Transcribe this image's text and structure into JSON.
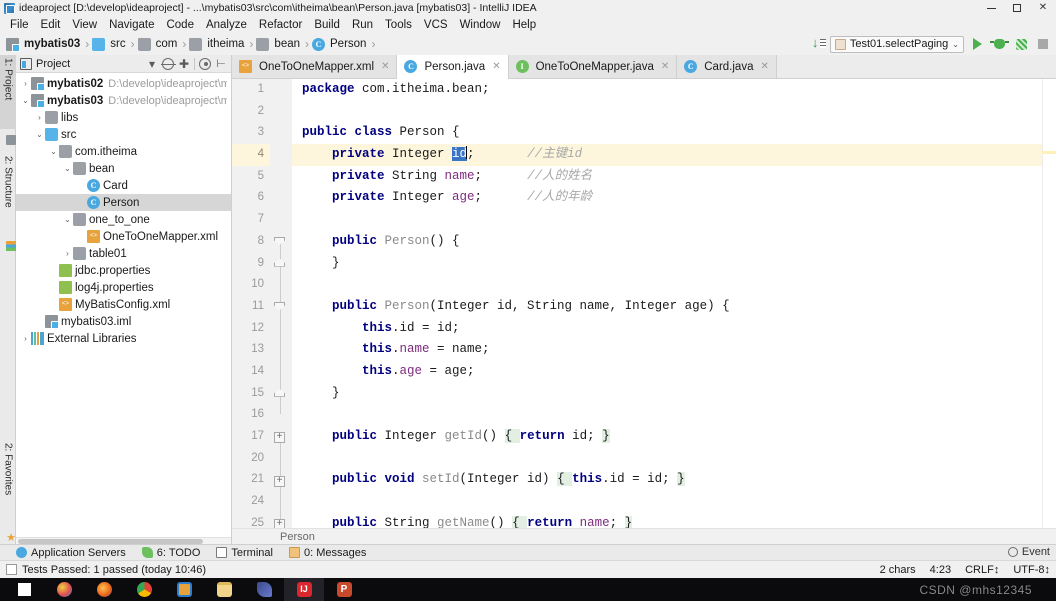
{
  "window": {
    "title": "ideaproject [D:\\develop\\ideaproject] - ...\\mybatis03\\src\\com\\itheima\\bean\\Person.java [mybatis03] - IntelliJ IDEA",
    "minimize": "–",
    "maximize": "□",
    "close": "✕"
  },
  "menu": {
    "items": [
      "File",
      "Edit",
      "View",
      "Navigate",
      "Code",
      "Analyze",
      "Refactor",
      "Build",
      "Run",
      "Tools",
      "VCS",
      "Window",
      "Help"
    ]
  },
  "breadcrumb": {
    "items": [
      {
        "label": "mybatis03",
        "icon": "module-icon",
        "bold": true
      },
      {
        "label": "src",
        "icon": "folder-blue-icon",
        "bold": false
      },
      {
        "label": "com",
        "icon": "folder-icon",
        "bold": false
      },
      {
        "label": "itheima",
        "icon": "folder-icon",
        "bold": false
      },
      {
        "label": "bean",
        "icon": "folder-icon",
        "bold": false
      },
      {
        "label": "Person",
        "icon": "class-icon",
        "bold": false
      }
    ],
    "separator": "›"
  },
  "run_toolbar": {
    "config_name": "Test01.selectPaging",
    "dropdown_chevron": "⌄",
    "buttons": [
      "run-button",
      "debug-button",
      "coverage-button",
      "stop-button"
    ],
    "download_icon": "update-project-icon"
  },
  "rail": {
    "items": [
      {
        "label": "1: Project",
        "icon": "project-icon",
        "selected": true
      },
      {
        "label": "2: Structure",
        "icon": "structure-icon",
        "selected": false
      },
      {
        "label": "2: Favorites",
        "icon": "favorites-star-icon",
        "selected": false
      }
    ]
  },
  "project_panel": {
    "title": "Project",
    "toolbar_icons": [
      "project-view-icon",
      "chevron-down-icon",
      "locate-icon",
      "expand-all-icon",
      "settings-gear-icon",
      "hide-panel-icon"
    ],
    "tree": [
      {
        "indent": 0,
        "arrow": "›",
        "icon": "module-icon",
        "label": "mybatis02",
        "bold": true,
        "path": "D:\\develop\\ideaproject\\m",
        "selected": false
      },
      {
        "indent": 0,
        "arrow": "⌄",
        "icon": "module-icon",
        "label": "mybatis03",
        "bold": true,
        "path": "D:\\develop\\ideaproject\\m",
        "selected": false
      },
      {
        "indent": 1,
        "arrow": "›",
        "icon": "folder-icon",
        "label": "libs",
        "bold": false,
        "path": "",
        "selected": false
      },
      {
        "indent": 1,
        "arrow": "⌄",
        "icon": "folder-blue-icon",
        "label": "src",
        "bold": false,
        "path": "",
        "selected": false
      },
      {
        "indent": 2,
        "arrow": "⌄",
        "icon": "folder-icon",
        "label": "com.itheima",
        "bold": false,
        "path": "",
        "selected": false
      },
      {
        "indent": 3,
        "arrow": "⌄",
        "icon": "folder-icon",
        "label": "bean",
        "bold": false,
        "path": "",
        "selected": false
      },
      {
        "indent": 4,
        "arrow": "",
        "icon": "class-icon",
        "label": "Card",
        "bold": false,
        "path": "",
        "selected": false
      },
      {
        "indent": 4,
        "arrow": "",
        "icon": "class-icon",
        "label": "Person",
        "bold": false,
        "path": "",
        "selected": true
      },
      {
        "indent": 3,
        "arrow": "⌄",
        "icon": "folder-icon",
        "label": "one_to_one",
        "bold": false,
        "path": "",
        "selected": false
      },
      {
        "indent": 4,
        "arrow": "",
        "icon": "xml-icon",
        "label": "OneToOneMapper.xml",
        "bold": false,
        "path": "",
        "selected": false
      },
      {
        "indent": 3,
        "arrow": "›",
        "icon": "folder-icon",
        "label": "table01",
        "bold": false,
        "path": "",
        "selected": false
      },
      {
        "indent": 2,
        "arrow": "",
        "icon": "properties-icon",
        "label": "jdbc.properties",
        "bold": false,
        "path": "",
        "selected": false
      },
      {
        "indent": 2,
        "arrow": "",
        "icon": "properties-icon",
        "label": "log4j.properties",
        "bold": false,
        "path": "",
        "selected": false
      },
      {
        "indent": 2,
        "arrow": "",
        "icon": "xml-icon",
        "label": "MyBatisConfig.xml",
        "bold": false,
        "path": "",
        "selected": false
      },
      {
        "indent": 1,
        "arrow": "",
        "icon": "module-icon",
        "label": "mybatis03.iml",
        "bold": false,
        "path": "",
        "selected": false
      },
      {
        "indent": 0,
        "arrow": "›",
        "icon": "libraries-icon",
        "label": "External Libraries",
        "bold": false,
        "path": "",
        "selected": false
      }
    ]
  },
  "editor": {
    "tabs": [
      {
        "label": "OneToOneMapper.xml",
        "icon": "xml-icon",
        "active": false,
        "close": "✕"
      },
      {
        "label": "Person.java",
        "icon": "class-icon",
        "active": true,
        "close": "✕"
      },
      {
        "label": "OneToOneMapper.java",
        "icon": "interface-icon",
        "active": false,
        "close": "✕"
      },
      {
        "label": "Card.java",
        "icon": "class-icon",
        "active": false,
        "close": "✕"
      }
    ],
    "line_numbers": [
      "1",
      "2",
      "3",
      "4",
      "5",
      "6",
      "7",
      "8",
      "9",
      "10",
      "11",
      "12",
      "13",
      "14",
      "15",
      "16",
      "17",
      "20",
      "21",
      "24",
      "25"
    ],
    "current_line_index": 3,
    "breadcrumb_label": "Person",
    "code_lines": [
      {
        "n": "1",
        "tokens": [
          {
            "t": "package ",
            "c": "kw"
          },
          {
            "t": "com.itheima.bean;",
            "c": "plain"
          }
        ]
      },
      {
        "n": "2",
        "tokens": []
      },
      {
        "n": "3",
        "tokens": [
          {
            "t": "public class ",
            "c": "kw"
          },
          {
            "t": "Person {",
            "c": "plain"
          }
        ]
      },
      {
        "n": "4",
        "tokens": [
          {
            "t": "    private ",
            "c": "kw"
          },
          {
            "t": "Integer ",
            "c": "plain"
          },
          {
            "t": "id",
            "c": "sel-tok"
          },
          {
            "t": ";",
            "c": "plain"
          },
          {
            "t": "       //主键id",
            "c": "cmt"
          }
        ]
      },
      {
        "n": "5",
        "tokens": [
          {
            "t": "    private ",
            "c": "kw"
          },
          {
            "t": "String ",
            "c": "plain"
          },
          {
            "t": "name",
            "c": "fld"
          },
          {
            "t": ";",
            "c": "plain"
          },
          {
            "t": "      //人的姓名",
            "c": "cmt"
          }
        ]
      },
      {
        "n": "6",
        "tokens": [
          {
            "t": "    private ",
            "c": "kw"
          },
          {
            "t": "Integer ",
            "c": "plain"
          },
          {
            "t": "age",
            "c": "fld"
          },
          {
            "t": ";",
            "c": "plain"
          },
          {
            "t": "      //人的年龄",
            "c": "cmt"
          }
        ]
      },
      {
        "n": "7",
        "tokens": []
      },
      {
        "n": "8",
        "tokens": [
          {
            "t": "    public ",
            "c": "kw"
          },
          {
            "t": "Person",
            "c": "mth"
          },
          {
            "t": "() {",
            "c": "plain"
          }
        ]
      },
      {
        "n": "9",
        "tokens": [
          {
            "t": "    }",
            "c": "plain"
          }
        ]
      },
      {
        "n": "10",
        "tokens": []
      },
      {
        "n": "11",
        "tokens": [
          {
            "t": "    public ",
            "c": "kw"
          },
          {
            "t": "Person",
            "c": "mth"
          },
          {
            "t": "(Integer id, String name, Integer age) {",
            "c": "plain"
          }
        ]
      },
      {
        "n": "12",
        "tokens": [
          {
            "t": "        this",
            "c": "kw"
          },
          {
            "t": ".",
            "c": "plain"
          },
          {
            "t": "id",
            "c": "plain"
          },
          {
            "t": " = id;",
            "c": "plain"
          }
        ]
      },
      {
        "n": "13",
        "tokens": [
          {
            "t": "        this",
            "c": "kw"
          },
          {
            "t": ".",
            "c": "plain"
          },
          {
            "t": "name",
            "c": "fld"
          },
          {
            "t": " = name;",
            "c": "plain"
          }
        ]
      },
      {
        "n": "14",
        "tokens": [
          {
            "t": "        this",
            "c": "kw"
          },
          {
            "t": ".",
            "c": "plain"
          },
          {
            "t": "age",
            "c": "fld"
          },
          {
            "t": " = age;",
            "c": "plain"
          }
        ]
      },
      {
        "n": "15",
        "tokens": [
          {
            "t": "    }",
            "c": "plain"
          }
        ]
      },
      {
        "n": "16",
        "tokens": []
      },
      {
        "n": "17",
        "tokens": [
          {
            "t": "    public ",
            "c": "kw"
          },
          {
            "t": "Integer ",
            "c": "plain"
          },
          {
            "t": "getId",
            "c": "mth"
          },
          {
            "t": "() ",
            "c": "plain"
          },
          {
            "t": "{ ",
            "c": "folded"
          },
          {
            "t": "return ",
            "c": "kw"
          },
          {
            "t": "id",
            "c": "plain"
          },
          {
            "t": "; ",
            "c": "plain"
          },
          {
            "t": "}",
            "c": "folded"
          }
        ]
      },
      {
        "n": "20",
        "tokens": []
      },
      {
        "n": "21",
        "tokens": [
          {
            "t": "    public void ",
            "c": "kw"
          },
          {
            "t": "setId",
            "c": "mth"
          },
          {
            "t": "(Integer id) ",
            "c": "plain"
          },
          {
            "t": "{ ",
            "c": "folded"
          },
          {
            "t": "this",
            "c": "kw"
          },
          {
            "t": ".",
            "c": "plain"
          },
          {
            "t": "id",
            "c": "plain"
          },
          {
            "t": " = id; ",
            "c": "plain"
          },
          {
            "t": "}",
            "c": "folded"
          }
        ]
      },
      {
        "n": "24",
        "tokens": []
      },
      {
        "n": "25",
        "tokens": [
          {
            "t": "    public ",
            "c": "kw"
          },
          {
            "t": "String ",
            "c": "plain"
          },
          {
            "t": "getName",
            "c": "mth"
          },
          {
            "t": "() ",
            "c": "plain"
          },
          {
            "t": "{ ",
            "c": "folded"
          },
          {
            "t": "return ",
            "c": "kw"
          },
          {
            "t": "name",
            "c": "fld"
          },
          {
            "t": "; ",
            "c": "plain"
          },
          {
            "t": "}",
            "c": "folded"
          }
        ]
      }
    ]
  },
  "bottom_toolwindows": [
    {
      "label": "Application Servers",
      "icon": "application-servers-icon",
      "mnemonic": ""
    },
    {
      "label": "6: TODO",
      "icon": "todo-icon",
      "mnemonic": "6"
    },
    {
      "label": "Terminal",
      "icon": "terminal-icon",
      "mnemonic": ""
    },
    {
      "label": "0: Messages",
      "icon": "messages-icon",
      "mnemonic": "0"
    }
  ],
  "status": {
    "test_result": "Tests Passed: 1 passed (today 10:46)",
    "event_log": "Event",
    "chars": "2 chars",
    "caret": "4:23",
    "line_separator": "CRLF↕",
    "encoding": "UTF-8↕"
  },
  "watermark": "CSDN @mhs12345",
  "taskbar": {
    "items": [
      "start-icon",
      "paint-icon",
      "firefox-icon",
      "chrome-icon",
      "explorer-icon",
      "folder-icon",
      "bird-icon",
      "intellij-icon",
      "powerpoint-icon"
    ]
  },
  "colors": {
    "accent_blue": "#49a8e0",
    "run_green": "#4caf50",
    "keyword": "#000080",
    "field": "#7d2a7d",
    "comment": "#a8a8a8",
    "selection": "#3a74c4",
    "current_line": "#fdf6dd",
    "folded_bg": "#e2efe2"
  }
}
